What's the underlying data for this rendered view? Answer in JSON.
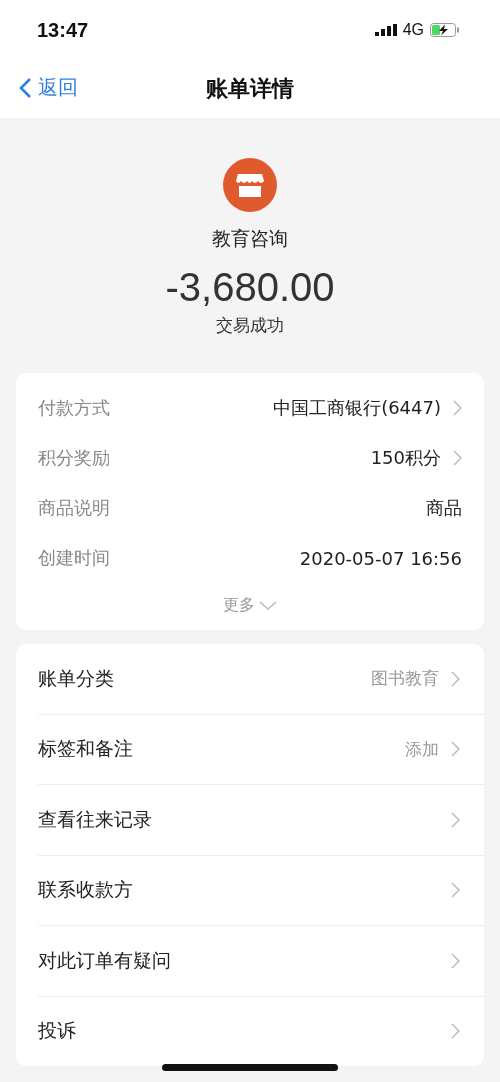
{
  "status_bar": {
    "time": "13:47",
    "network": "4G",
    "charging": true
  },
  "nav": {
    "back": "返回",
    "title": "账单详情"
  },
  "merchant": {
    "name": "教育咨询",
    "amount": "-3,680.00",
    "status": "交易成功"
  },
  "details": {
    "rows": [
      {
        "label": "付款方式",
        "value": "中国工商银行(6447)",
        "arrow": true
      },
      {
        "label": "积分奖励",
        "value": "150积分",
        "arrow": true
      },
      {
        "label": "商品说明",
        "value": "商品",
        "arrow": false
      },
      {
        "label": "创建时间",
        "value": "2020-05-07 16:56",
        "arrow": false
      }
    ],
    "more": "更多"
  },
  "actions": [
    {
      "label": "账单分类",
      "value": "图书教育",
      "arrow": true
    },
    {
      "label": "标签和备注",
      "value": "添加",
      "arrow": true
    },
    {
      "label": "查看往来记录",
      "arrow": true
    },
    {
      "label": "联系收款方",
      "arrow": true
    },
    {
      "label": "对此订单有疑问",
      "arrow": true
    },
    {
      "label": "投诉",
      "arrow": true
    }
  ]
}
